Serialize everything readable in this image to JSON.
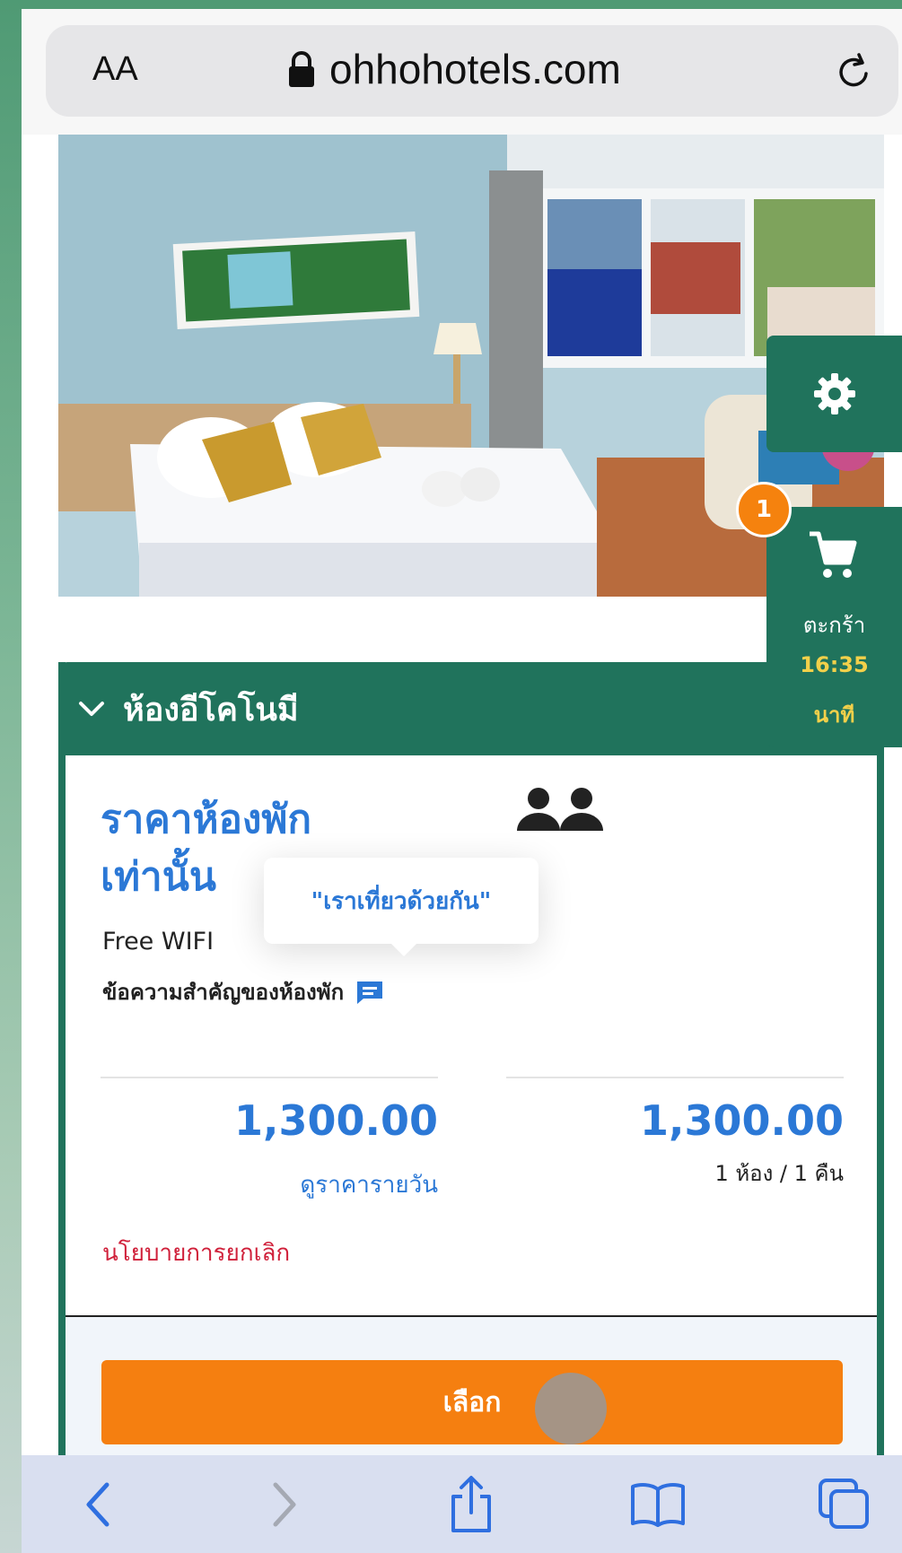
{
  "browser": {
    "text_size_label": "AA",
    "url": "ohhohotels.com"
  },
  "side_tabs": {
    "cart_count": "1",
    "cart_label": "ตะกร้า",
    "cart_timer": "16:35",
    "cart_timer_unit": "นาที"
  },
  "room": {
    "name": "ห้องอีโคโนมี",
    "rate_title": "ราคาห้องพัก เท่านั้น",
    "amenity": "Free WIFI",
    "important_message_label": "ข้อความสำคัญของห้องพัก",
    "tooltip_text": "\"เราเที่ยวด้วยกัน\"",
    "daily_price": "1,300.00",
    "daily_rate_link": "ดูราคารายวัน",
    "total_price": "1,300.00",
    "total_unit": "1 ห้อง / 1 คืน",
    "cancellation_policy": "นโยบายการยกเลิก",
    "select_button": "เลือก"
  },
  "colors": {
    "brand_green": "#20735c",
    "price_blue": "#2b78d6",
    "select_orange": "#f57f10",
    "badge_orange": "#f5820e",
    "timer_yellow": "#f2d04a",
    "policy_red": "#d0203a"
  },
  "toolbar_icons": [
    "back-icon",
    "forward-icon",
    "share-icon",
    "bookmarks-icon",
    "tabs-icon"
  ]
}
